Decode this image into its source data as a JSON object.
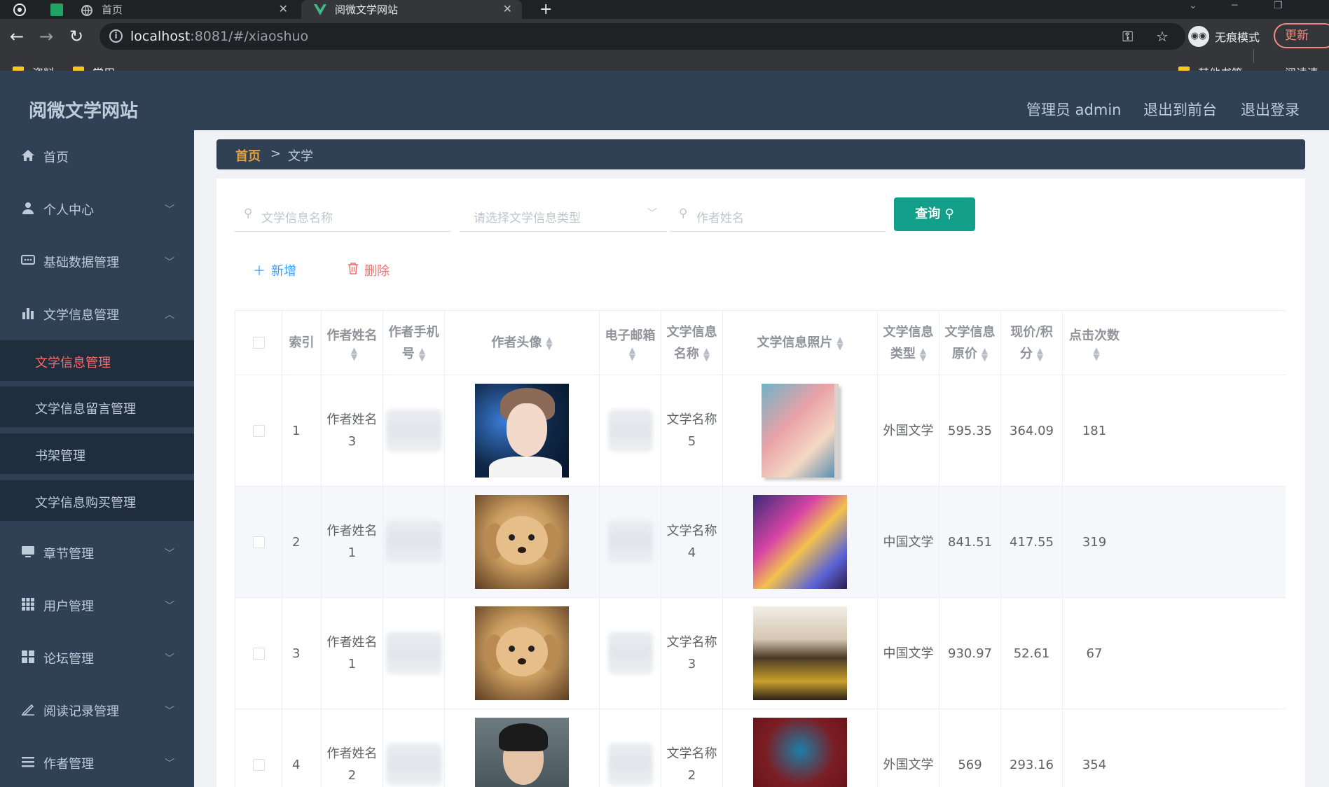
{
  "browser": {
    "tabs": [
      {
        "label": "首页",
        "active": false
      },
      {
        "label": "阅微文学网站",
        "active": true
      }
    ],
    "new_tab": "+",
    "url_host": "localhost",
    "url_rest": ":8081/#/xiaoshuo",
    "incognito_label": "无痕模式",
    "update_label": "更新",
    "bookmarks": [
      {
        "label": "资料",
        "icon": "folder-icon"
      },
      {
        "label": "常用",
        "icon": "folder-icon"
      }
    ],
    "other_bookmarks": "其他书签",
    "reading_list": "阅读清单"
  },
  "header": {
    "brand": "阅微文学网站",
    "admin": "管理员 admin",
    "to_front": "退出到前台",
    "logout": "退出登录"
  },
  "sidebar": {
    "items": [
      {
        "label": "首页",
        "icon": "home-icon"
      },
      {
        "label": "个人中心",
        "icon": "user-icon"
      },
      {
        "label": "基础数据管理",
        "icon": "chat-icon"
      },
      {
        "label": "文学信息管理",
        "icon": "bar-chart-icon"
      },
      {
        "label": "章节管理",
        "icon": "monitor-icon"
      },
      {
        "label": "用户管理",
        "icon": "grid-icon"
      },
      {
        "label": "论坛管理",
        "icon": "apps-icon"
      },
      {
        "label": "阅读记录管理",
        "icon": "pen-icon"
      },
      {
        "label": "作者管理",
        "icon": "menu-icon"
      }
    ],
    "subitems": [
      {
        "label": "文学信息管理",
        "active": true
      },
      {
        "label": "文学信息留言管理",
        "active": false
      },
      {
        "label": "书架管理",
        "active": false
      },
      {
        "label": "文学信息购买管理",
        "active": false
      }
    ]
  },
  "breadcrumb": {
    "home": "首页",
    "separator": ">",
    "current": "文学"
  },
  "search": {
    "name_placeholder": "文学信息名称",
    "type_placeholder": "请选择文学信息类型",
    "author_placeholder": "作者姓名",
    "query_label": "查询"
  },
  "actions": {
    "add_label": "新增",
    "delete_label": "删除"
  },
  "table": {
    "headers": {
      "index": "索引",
      "author_name": [
        "作者姓名",
        ""
      ],
      "author_phone": [
        "作者手机",
        "号"
      ],
      "author_avatar": "作者头像",
      "email": [
        "电子邮箱",
        ""
      ],
      "title": [
        "文学信息",
        "名称"
      ],
      "photo": "文学信息照片",
      "type": [
        "文学信息",
        "类型"
      ],
      "orig_price": [
        "文学信息",
        "原价"
      ],
      "now_price": [
        "现价/积",
        "分"
      ],
      "clicks": [
        "点击次数",
        ""
      ]
    },
    "rows": [
      {
        "index": "1",
        "author": [
          "作者姓名",
          "3"
        ],
        "title": [
          "文学名称",
          "5"
        ],
        "type": "外国文学",
        "orig": "595.35",
        "now": "364.09",
        "clicks": "181",
        "avatar": "boy",
        "cover": "cover1"
      },
      {
        "index": "2",
        "author": [
          "作者姓名",
          "1"
        ],
        "title": [
          "文学名称",
          "4"
        ],
        "type": "中国文学",
        "orig": "841.51",
        "now": "417.55",
        "clicks": "319",
        "avatar": "dog",
        "cover": "cover2"
      },
      {
        "index": "3",
        "author": [
          "作者姓名",
          "1"
        ],
        "title": [
          "文学名称",
          "3"
        ],
        "type": "中国文学",
        "orig": "930.97",
        "now": "52.61",
        "clicks": "67",
        "avatar": "dog",
        "cover": "cover3"
      },
      {
        "index": "4",
        "author": [
          "作者姓名",
          "2"
        ],
        "title": [
          "文学名称",
          "2"
        ],
        "type": "外国文学",
        "orig": "569",
        "now": "293.16",
        "clicks": "354",
        "avatar": "man",
        "cover": "cover4"
      }
    ]
  },
  "colors": {
    "header_bg": "#304156",
    "sidebar_active": "#f56c6c",
    "query_btn": "#13a08b",
    "add_btn": "#409eff",
    "delete_btn": "#f56c6c",
    "breadcrumb_home": "#e6a23c"
  }
}
